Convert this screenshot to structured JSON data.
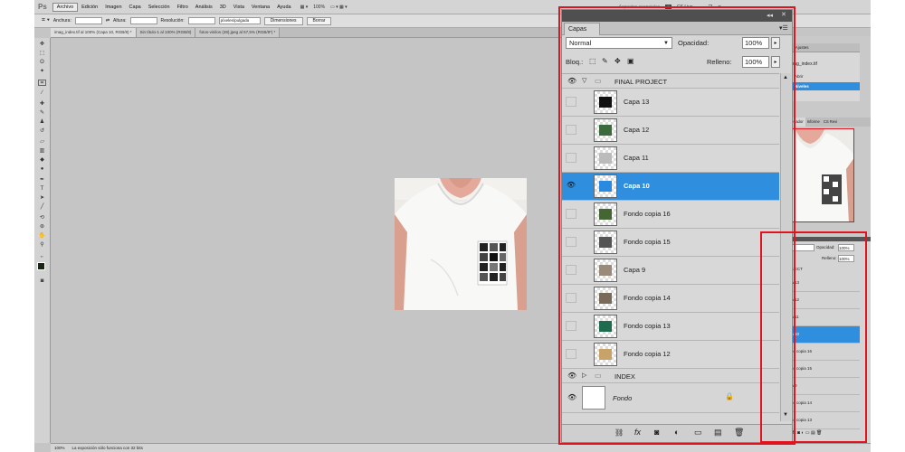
{
  "menubar": {
    "logo": "Ps",
    "items": [
      "Archivo",
      "Edición",
      "Imagen",
      "Capa",
      "Selección",
      "Filtro",
      "Análisis",
      "3D",
      "Vista",
      "Ventana",
      "Ayuda"
    ],
    "zoom": "100%",
    "right_text": "Aspectos esenciales",
    "cslive": "CS Live"
  },
  "options": {
    "width_label": "Anchura:",
    "height_label": "Altura:",
    "resolution_label": "Resolución:",
    "resolution_unit": "píxeles/pulgada",
    "dimensions_button": "Dimensiones",
    "clear_button": "Borrar"
  },
  "doc_tabs": [
    "imag_index.tif al 100% (Capa 10, RGB/8) *",
    "Sin título-1 al 100% (RGB/8)",
    "fotos-vinilos (28).jpeg al 57,5% (RGB/8*) *"
  ],
  "status": {
    "zoom": "100%",
    "message": "La exposición sólo funciona con 32 bits"
  },
  "layers_panel": {
    "tab": "Capas",
    "blend_mode": "Normal",
    "opacity_label": "Opacidad:",
    "opacity_value": "100%",
    "lock_label": "Bloq.:",
    "fill_label": "Relleno:",
    "fill_value": "100%",
    "group_name": "FINAL PROJECT",
    "layers": [
      {
        "name": "Capa 13",
        "visible": false,
        "selected": false
      },
      {
        "name": "Capa 12",
        "visible": false,
        "selected": false
      },
      {
        "name": "Capa 11",
        "visible": false,
        "selected": false
      },
      {
        "name": "Capa 10",
        "visible": true,
        "selected": true
      },
      {
        "name": "Fondo copia 16",
        "visible": false,
        "selected": false
      },
      {
        "name": "Fondo copia 15",
        "visible": false,
        "selected": false
      },
      {
        "name": "Capa 9",
        "visible": false,
        "selected": false
      },
      {
        "name": "Fondo copia 14",
        "visible": false,
        "selected": false
      },
      {
        "name": "Fondo copia 13",
        "visible": false,
        "selected": false
      },
      {
        "name": "Fondo copia 12",
        "visible": false,
        "selected": false
      }
    ],
    "index_group": "INDEX",
    "background_layer": "Fondo"
  },
  "history_panel": {
    "tabs": [
      "oria",
      "Acciones",
      "Ajustes"
    ],
    "doc": "imag_index.tif",
    "items": [
      "Abrir",
      "Niveles"
    ]
  },
  "navigator_panel": {
    "tabs": [
      "de",
      "CS Nev",
      "Navegador",
      "Informe",
      "CS Revi"
    ]
  },
  "small_layers": {
    "opacity_label": "Opacidad:",
    "opacity_value": "100%",
    "fill_label": "Relleno:",
    "fill_value": "100%",
    "group_name": "FINAL PROJECT",
    "layers": [
      "Capa 13",
      "Capa 12",
      "Capa 11",
      "Capa 10",
      "Fondo copia 16",
      "Fondo copia 15",
      "Capa 9",
      "Fondo copia 14",
      "Fondo copia 13"
    ]
  },
  "colors": {
    "selected": "#2f8fde",
    "highlight": "#e0141e"
  }
}
